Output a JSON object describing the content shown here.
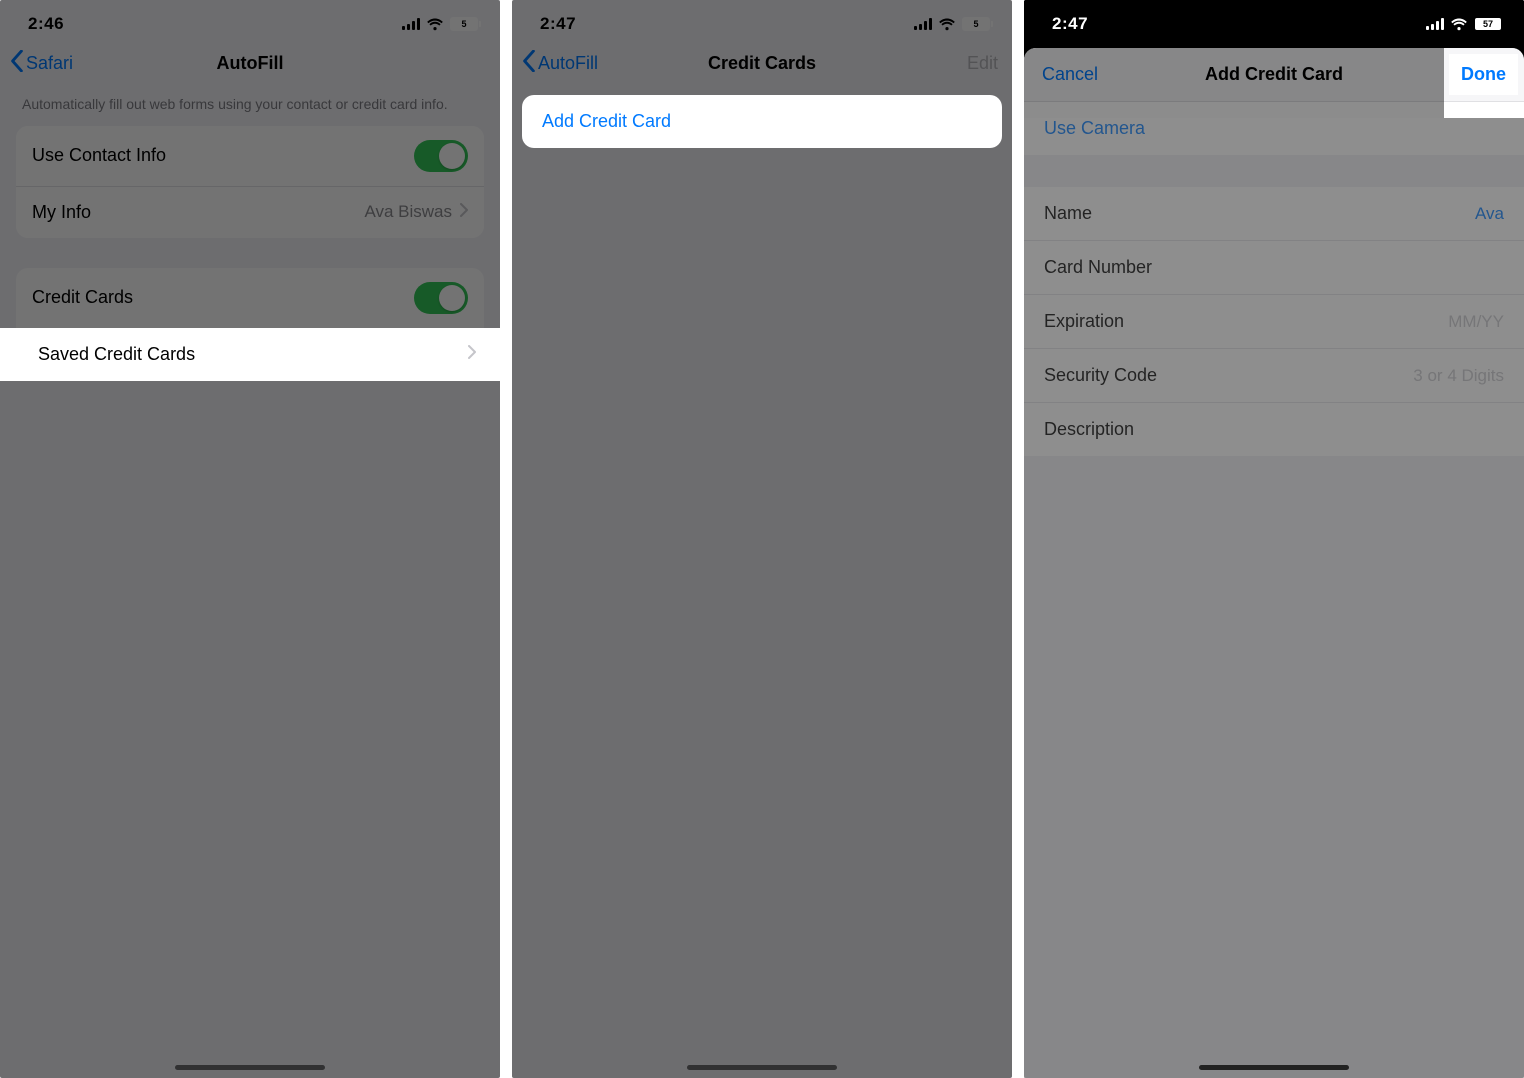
{
  "phone1": {
    "status": {
      "time": "2:46",
      "battery": "5"
    },
    "nav": {
      "back": "Safari",
      "title": "AutoFill"
    },
    "note": "Automatically fill out web forms using your contact or credit card info.",
    "rows": {
      "useContact": "Use Contact Info",
      "myInfo": "My Info",
      "myInfoValue": "Ava Biswas",
      "creditCards": "Credit Cards",
      "savedCards": "Saved Credit Cards"
    }
  },
  "phone2": {
    "status": {
      "time": "2:47",
      "battery": "5"
    },
    "nav": {
      "back": "AutoFill",
      "title": "Credit Cards",
      "edit": "Edit"
    },
    "addCard": "Add Credit Card"
  },
  "phone3": {
    "status": {
      "time": "2:47",
      "battery": "57"
    },
    "nav": {
      "cancel": "Cancel",
      "title": "Add Credit Card",
      "done": "Done"
    },
    "rows": {
      "useCamera": "Use Camera",
      "name": "Name",
      "nameValue": "Ava",
      "cardNumber": "Card Number",
      "expiration": "Expiration",
      "expirationPH": "MM/YY",
      "security": "Security Code",
      "securityPH": "3 or 4 Digits",
      "description": "Description"
    }
  }
}
